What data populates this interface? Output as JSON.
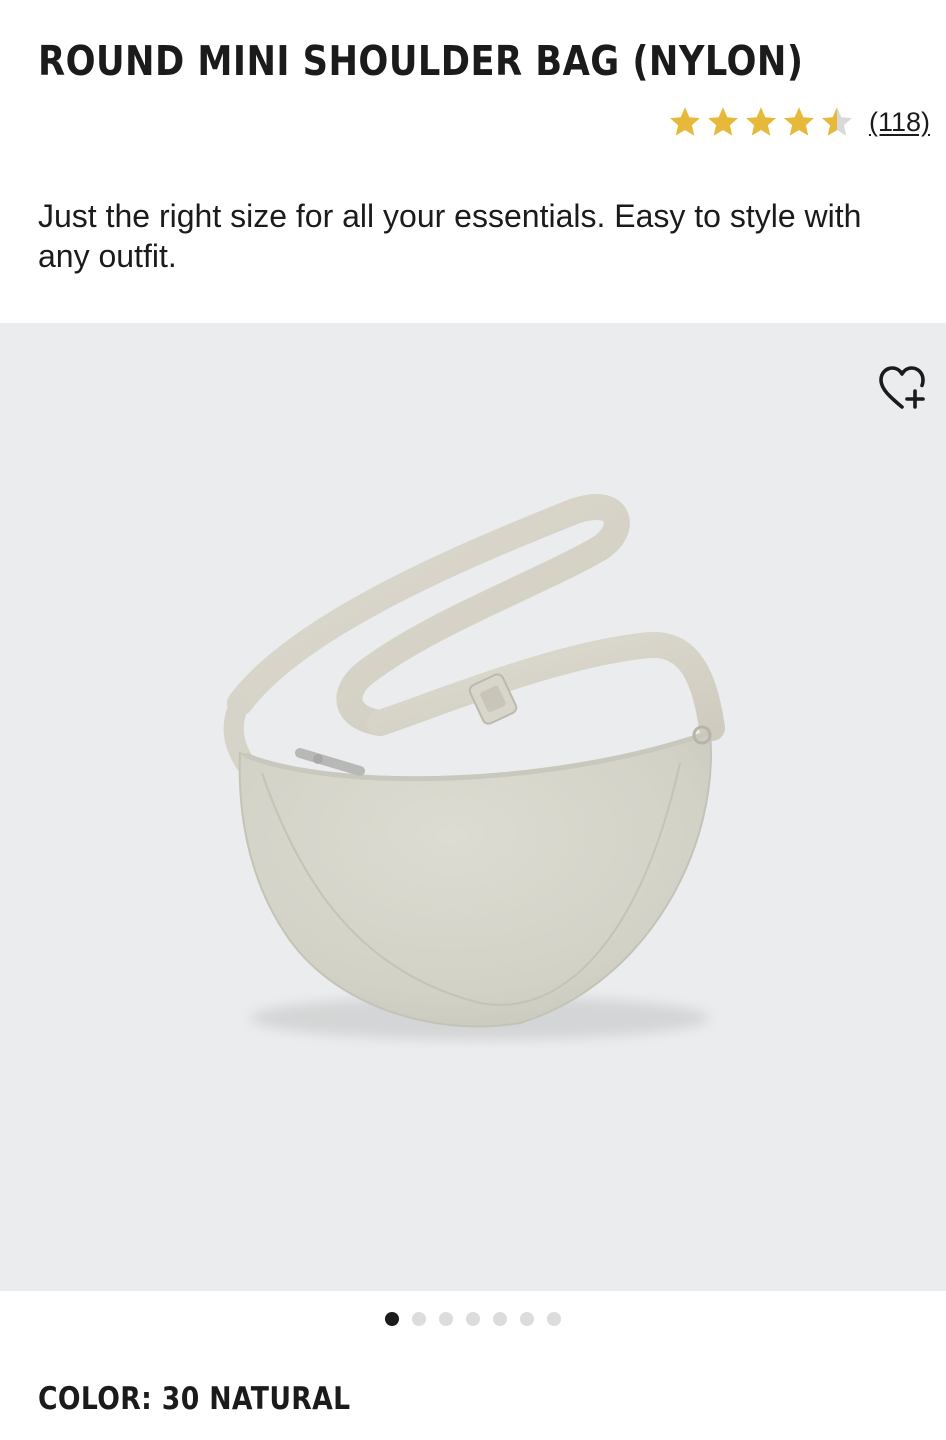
{
  "product": {
    "title": "ROUND MINI SHOULDER BAG (NYLON)",
    "rating": {
      "value": 4.5,
      "max": 5,
      "review_count_label": "(118)",
      "star_color": "#e7b93a",
      "empty_star_color": "#d9d9d9"
    },
    "description": "Just the right size for all your essentials. Easy to style with any outfit.",
    "color": {
      "label": "COLOR: 30 NATURAL"
    }
  },
  "gallery": {
    "image_count": 7,
    "active_index": 0,
    "background": "#ebecee",
    "wishlist_icon": "heart-plus-icon"
  }
}
